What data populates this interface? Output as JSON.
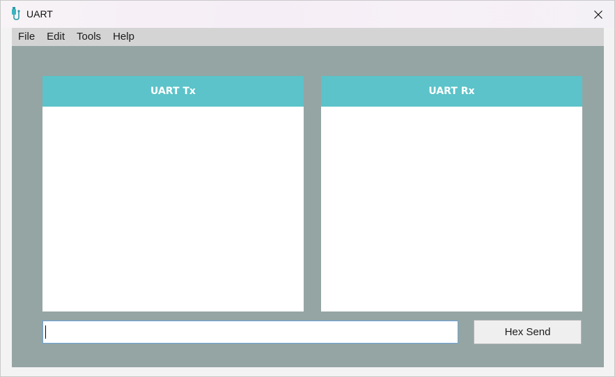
{
  "window": {
    "title": "UART",
    "icon": "usb-plug-icon"
  },
  "menu": {
    "items": [
      {
        "label": "File"
      },
      {
        "label": "Edit"
      },
      {
        "label": "Tools"
      },
      {
        "label": "Help"
      }
    ]
  },
  "panels": {
    "tx": {
      "title": "UART Tx",
      "content": ""
    },
    "rx": {
      "title": "UART Rx",
      "content": ""
    }
  },
  "input": {
    "value": "",
    "placeholder": ""
  },
  "send_button": {
    "label": "Hex Send"
  },
  "colors": {
    "client_bg": "#95a5a3",
    "panel_header": "#5bc3c9",
    "menubar": "#d4d4d4",
    "input_border": "#6aa3d8"
  }
}
